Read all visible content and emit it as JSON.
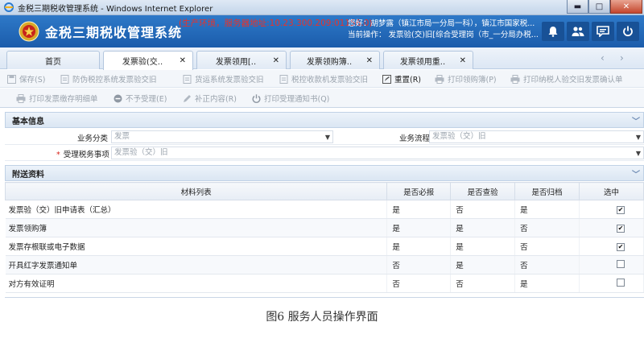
{
  "window": {
    "title": "金税三期税收管理系统 - Windows Internet Explorer",
    "controls": {
      "minimize": "▬",
      "maximize": "□",
      "close": "✕"
    }
  },
  "header": {
    "app_name": "金税三期税收管理系统",
    "environment": "(生产环境，服务器地址:10.23.300.209:01156.0)",
    "user_line": "您好：胡梦露（镇江市局一分局一科），镇江市国家税...",
    "operation_line": "当前操作：  发票验(交)旧[综合受理岗（市_一分局办税...",
    "icons": [
      "bell-icon",
      "users-icon",
      "chat-icon",
      "power-icon"
    ]
  },
  "tabs": [
    {
      "label": "首页",
      "closable": false
    },
    {
      "label": "发票验(交..",
      "closable": true,
      "active": true
    },
    {
      "label": "发票领用[..",
      "closable": true
    },
    {
      "label": "发票领购簿..",
      "closable": true
    },
    {
      "label": "发票领用重..",
      "closable": true
    }
  ],
  "tab_nav": {
    "prev": "‹",
    "next": "›"
  },
  "toolbar1": [
    {
      "label": "保存(S)",
      "icon": "save-icon",
      "enabled": false
    },
    {
      "label": "防伪税控系统发票验交旧",
      "icon": "document-icon",
      "enabled": false
    },
    {
      "label": "货运系统发票验交旧",
      "icon": "document-icon",
      "enabled": false
    },
    {
      "label": "税控收款机发票验交旧",
      "icon": "document-icon",
      "enabled": false
    },
    {
      "label": "重置(R)",
      "icon": "reset-icon",
      "enabled": true
    },
    {
      "label": "打印领购簿(P)",
      "icon": "printer-icon",
      "enabled": false
    },
    {
      "label": "打印纳税人验交旧发票确认单",
      "icon": "printer-icon",
      "enabled": false
    }
  ],
  "toolbar2": [
    {
      "label": "打印发票缴存明细单",
      "icon": "printer-icon",
      "enabled": false
    },
    {
      "label": "不予受理(E)",
      "icon": "reject-icon",
      "enabled": false
    },
    {
      "label": "补正内容(R)",
      "icon": "pencil-icon",
      "enabled": false
    },
    {
      "label": "打印受理通知书(Q)",
      "icon": "notice-icon",
      "enabled": false
    }
  ],
  "basic_info": {
    "title": "基本信息",
    "business_category_label": "业务分类",
    "business_category_value": "发票",
    "business_flow_label": "业务流程",
    "business_flow_value": "发票验（交）旧",
    "tax_matter_required": "*",
    "tax_matter_label": "受理税务事项",
    "tax_matter_value": "发票验（交）旧"
  },
  "attachments": {
    "title": "附送资料",
    "columns": [
      "材料列表",
      "是否必报",
      "是否查验",
      "是否归档",
      "选中"
    ],
    "rows": [
      {
        "name": "发票验（交）旧申请表（汇总）",
        "required": "是",
        "inspect": "否",
        "archive": "是",
        "checked": true
      },
      {
        "name": "发票领购簿",
        "required": "是",
        "inspect": "是",
        "archive": "否",
        "checked": true
      },
      {
        "name": "发票存根联或电子数据",
        "required": "是",
        "inspect": "是",
        "archive": "否",
        "checked": true
      },
      {
        "name": "开具红字发票通知单",
        "required": "否",
        "inspect": "是",
        "archive": "否",
        "checked": false
      },
      {
        "name": "对方有效证明",
        "required": "否",
        "inspect": "否",
        "archive": "是",
        "checked": false
      }
    ]
  },
  "caption": "图6 服务人员操作界面"
}
